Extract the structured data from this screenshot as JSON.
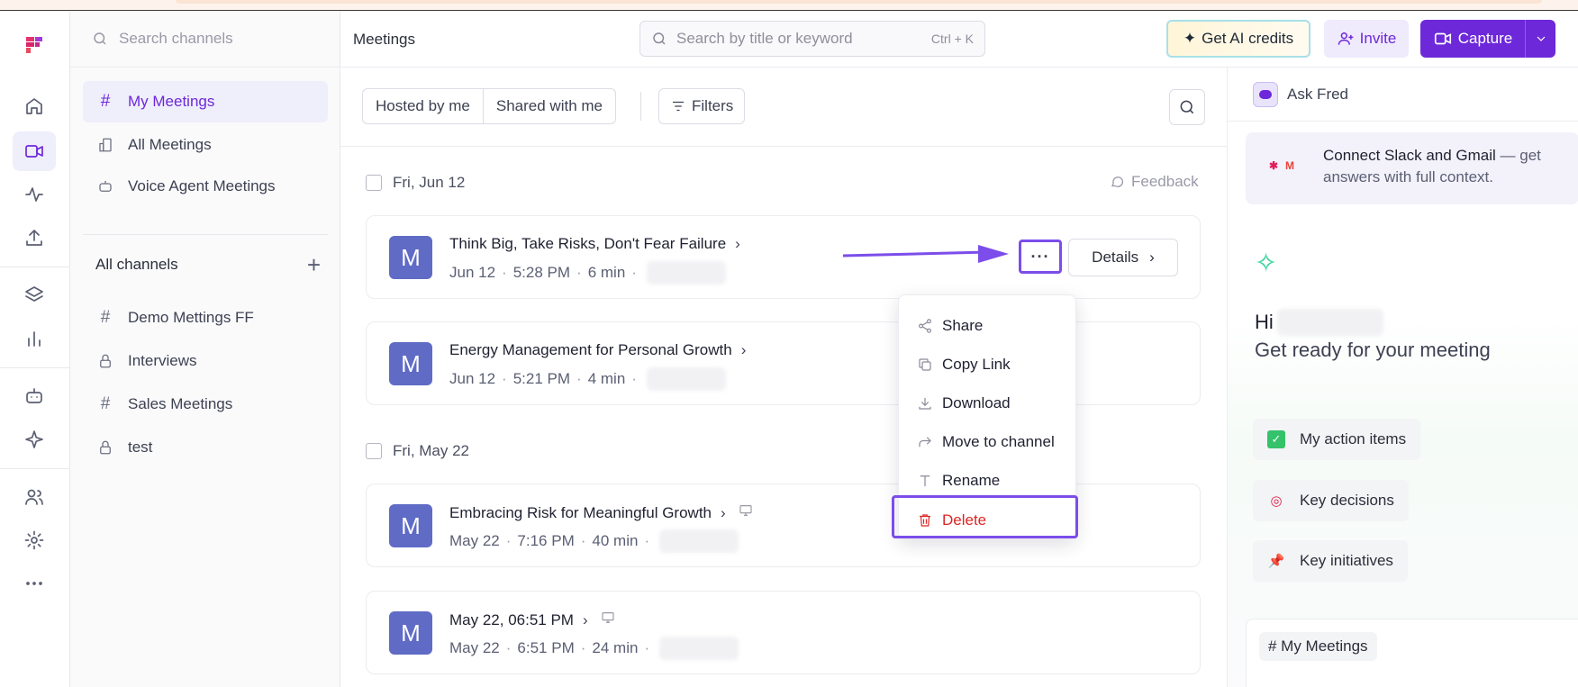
{
  "sidebar": {
    "search_placeholder": "Search channels",
    "nav": [
      {
        "label": "My Meetings"
      },
      {
        "label": "All Meetings"
      },
      {
        "label": "Voice Agent Meetings"
      }
    ],
    "channels_header": "All channels",
    "channels": [
      {
        "label": "Demo Mettings FF",
        "icon": "hash-icon"
      },
      {
        "label": "Interviews",
        "icon": "lock-icon"
      },
      {
        "label": "Sales Meetings",
        "icon": "hash-icon"
      },
      {
        "label": "test",
        "icon": "lock-icon"
      }
    ]
  },
  "header": {
    "title": "Meetings",
    "search_placeholder": "Search by title or keyword",
    "search_shortcut": "Ctrl + K",
    "credits_label": "Get AI credits",
    "invite_label": "Invite",
    "capture_label": "Capture"
  },
  "filters": {
    "hosted": "Hosted by me",
    "shared": "Shared with me",
    "filters_label": "Filters"
  },
  "list": {
    "feedback_label": "Feedback",
    "groups": [
      {
        "date": "Fri, Jun 12",
        "meetings": [
          {
            "avatar": "M",
            "title": "Think Big, Take Risks, Don't Fear Failure",
            "date": "Jun 12",
            "time": "5:28 PM",
            "duration": "6 min"
          },
          {
            "avatar": "M",
            "title": "Energy Management for Personal Growth",
            "date": "Jun 12",
            "time": "5:21 PM",
            "duration": "4 min"
          }
        ]
      },
      {
        "date": "Fri, May 22",
        "meetings": [
          {
            "avatar": "M",
            "title": "Embracing Risk for Meaningful Growth",
            "date": "May 22",
            "time": "7:16 PM",
            "duration": "40 min"
          },
          {
            "avatar": "M",
            "title": "May 22, 06:51 PM",
            "date": "May 22",
            "time": "6:51 PM",
            "duration": "24 min"
          }
        ]
      }
    ],
    "more_label": "···",
    "details_label": "Details"
  },
  "menu": {
    "items": [
      {
        "label": "Share"
      },
      {
        "label": "Copy Link"
      },
      {
        "label": "Download"
      },
      {
        "label": "Move to channel"
      },
      {
        "label": "Rename"
      },
      {
        "label": "Delete"
      }
    ]
  },
  "right": {
    "ask_label": "Ask Fred",
    "connect_title": "Connect Slack and Gmail",
    "connect_rest": " — get answers with full context.",
    "hi": "Hi",
    "ready": "Get ready for your meeting",
    "chips": [
      {
        "label": "My action items"
      },
      {
        "label": "Key decisions"
      },
      {
        "label": "Key initiatives"
      }
    ],
    "channel_chip": "# My Meetings"
  },
  "colors": {
    "accent": "#6d28d9",
    "avatar": "#5f6bc5",
    "danger": "#dc2626"
  }
}
